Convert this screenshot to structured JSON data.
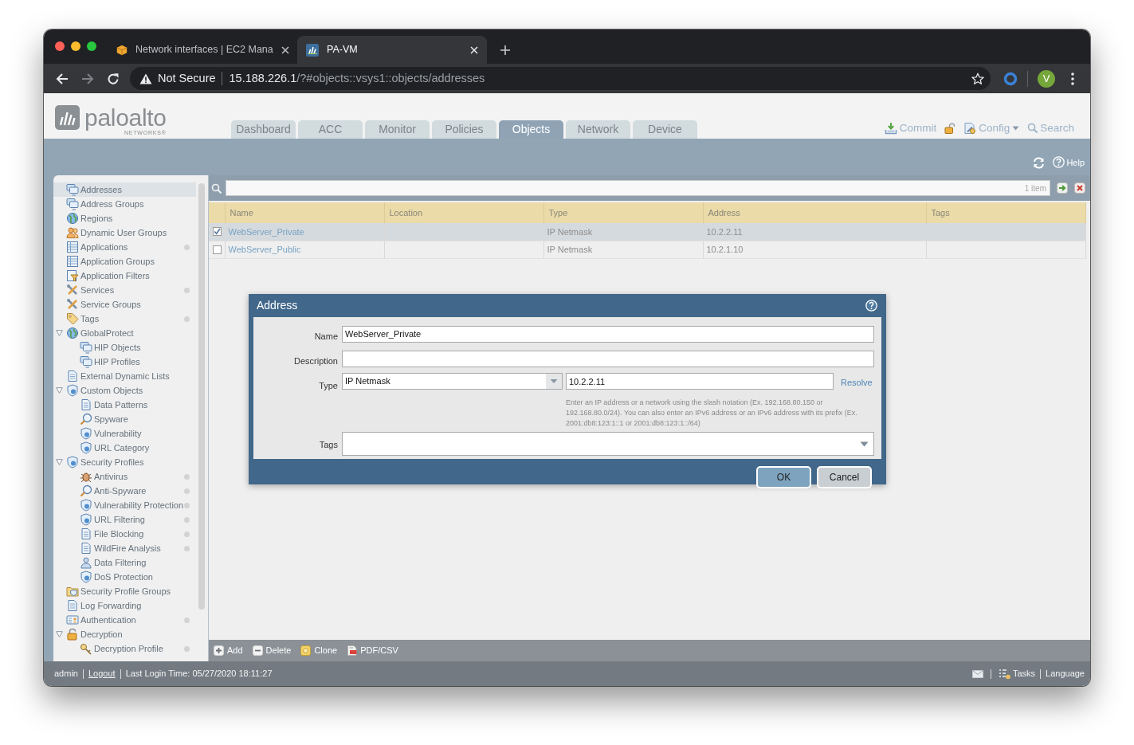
{
  "browser": {
    "tabs": [
      {
        "title": "Network interfaces | EC2 Mana",
        "selected": false
      },
      {
        "title": "PA-VM",
        "selected": true
      }
    ],
    "address_bar": {
      "security": "Not Secure",
      "host": "15.188.226.1",
      "path": "/?#objects::vsys1::objects/addresses"
    },
    "profile": "V"
  },
  "app": {
    "logo": {
      "name": "paloalto",
      "tagline": "NETWORKS®"
    },
    "nav_tabs": [
      {
        "label": "Dashboard",
        "selected": false
      },
      {
        "label": "ACC",
        "selected": false
      },
      {
        "label": "Monitor",
        "selected": false
      },
      {
        "label": "Policies",
        "selected": false
      },
      {
        "label": "Objects",
        "selected": true
      },
      {
        "label": "Network",
        "selected": false
      },
      {
        "label": "Device",
        "selected": false
      }
    ],
    "header_actions": {
      "commit": "Commit",
      "config": "Config",
      "search": "Search"
    },
    "help": "Help"
  },
  "sidebar": {
    "items": [
      {
        "label": "Addresses",
        "selected": true,
        "indicator": false
      },
      {
        "label": "Address Groups",
        "selected": false,
        "indicator": false
      },
      {
        "label": "Regions",
        "selected": false,
        "indicator": false
      },
      {
        "label": "Dynamic User Groups",
        "selected": false,
        "indicator": false
      },
      {
        "label": "Applications",
        "selected": false,
        "indicator": true
      },
      {
        "label": "Application Groups",
        "selected": false,
        "indicator": false
      },
      {
        "label": "Application Filters",
        "selected": false,
        "indicator": false
      },
      {
        "label": "Services",
        "selected": false,
        "indicator": true
      },
      {
        "label": "Service Groups",
        "selected": false,
        "indicator": false
      },
      {
        "label": "Tags",
        "selected": false,
        "indicator": true
      },
      {
        "label": "GlobalProtect",
        "selected": false,
        "indicator": false,
        "expanded": true,
        "children": [
          {
            "label": "HIP Objects",
            "selected": false,
            "indicator": false
          },
          {
            "label": "HIP Profiles",
            "selected": false,
            "indicator": false
          }
        ]
      },
      {
        "label": "External Dynamic Lists",
        "selected": false,
        "indicator": false
      },
      {
        "label": "Custom Objects",
        "selected": false,
        "indicator": false,
        "expanded": true,
        "children": [
          {
            "label": "Data Patterns",
            "selected": false,
            "indicator": false
          },
          {
            "label": "Spyware",
            "selected": false,
            "indicator": false
          },
          {
            "label": "Vulnerability",
            "selected": false,
            "indicator": false
          },
          {
            "label": "URL Category",
            "selected": false,
            "indicator": false
          }
        ]
      },
      {
        "label": "Security Profiles",
        "selected": false,
        "indicator": false,
        "expanded": true,
        "children": [
          {
            "label": "Antivirus",
            "selected": false,
            "indicator": true
          },
          {
            "label": "Anti-Spyware",
            "selected": false,
            "indicator": true
          },
          {
            "label": "Vulnerability Protection",
            "selected": false,
            "indicator": true
          },
          {
            "label": "URL Filtering",
            "selected": false,
            "indicator": true
          },
          {
            "label": "File Blocking",
            "selected": false,
            "indicator": true
          },
          {
            "label": "WildFire Analysis",
            "selected": false,
            "indicator": true
          },
          {
            "label": "Data Filtering",
            "selected": false,
            "indicator": false
          },
          {
            "label": "DoS Protection",
            "selected": false,
            "indicator": false
          }
        ]
      },
      {
        "label": "Security Profile Groups",
        "selected": false,
        "indicator": false
      },
      {
        "label": "Log Forwarding",
        "selected": false,
        "indicator": false
      },
      {
        "label": "Authentication",
        "selected": false,
        "indicator": true
      },
      {
        "label": "Decryption",
        "selected": false,
        "indicator": false,
        "expanded": true,
        "children": [
          {
            "label": "Decryption Profile",
            "selected": false,
            "indicator": true
          }
        ]
      }
    ]
  },
  "filter": {
    "count": "1 item"
  },
  "table": {
    "columns": [
      "Name",
      "Location",
      "Type",
      "Address",
      "Tags"
    ],
    "rows": [
      {
        "selected": true,
        "checked": true,
        "name": "WebServer_Private",
        "type": "IP Netmask",
        "address": "10.2.2.11"
      },
      {
        "selected": false,
        "checked": false,
        "name": "WebServer_Public",
        "type": "IP Netmask",
        "address": "10.2.1.10"
      }
    ]
  },
  "toolbar": [
    {
      "kind": "add",
      "label": "Add"
    },
    {
      "kind": "delete",
      "label": "Delete"
    },
    {
      "kind": "clone",
      "label": "Clone"
    },
    {
      "kind": "export",
      "label": "PDF/CSV"
    }
  ],
  "dialog": {
    "title": "Address",
    "fields": [
      {
        "kind": "text",
        "label": "Name",
        "value": "WebServer_Private"
      },
      {
        "kind": "text",
        "label": "Description"
      },
      {
        "kind": "select",
        "label": "Type",
        "value": "IP Netmask",
        "address": "10.2.2.11",
        "action": "Resolve",
        "hint": "Enter an IP address or a network using the slash notation (Ex. 192.168.80.150 or 192.168.80.0/24). You can also enter an IPv6 address or an IPv6 address with its prefix (Ex. 2001:db8:123:1::1 or 2001:db8:123:1::/64)"
      },
      {
        "kind": "multiselect",
        "label": "Tags"
      }
    ],
    "buttons": [
      {
        "label": "OK",
        "kind": "primary"
      },
      {
        "label": "Cancel",
        "kind": "secondary"
      }
    ]
  },
  "footer": {
    "user": "admin",
    "logout": "Logout",
    "last_login": "Last Login Time: 05/27/2020 18:11:27",
    "tasks": "Tasks",
    "language": "Language"
  }
}
